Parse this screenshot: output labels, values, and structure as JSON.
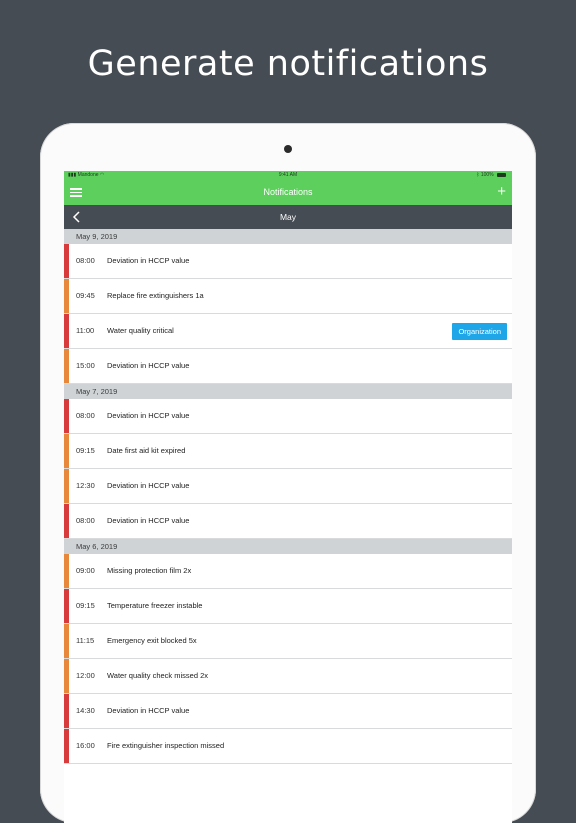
{
  "headline": "Generate notifications",
  "status_bar": {
    "carrier": "Mandone",
    "time": "9:41 AM",
    "battery": "100%"
  },
  "app_bar": {
    "title": "Notifications"
  },
  "month_bar": {
    "title": "May"
  },
  "colors": {
    "red": "#d73b3b",
    "orange": "#e8883a",
    "green": "#5ccf5c",
    "dark": "#454c53",
    "badge": "#1fa6e8"
  },
  "groups": [
    {
      "date": "May 9, 2019",
      "items": [
        {
          "time": "08:00",
          "text": "Deviation in HCCP value",
          "level": "red"
        },
        {
          "time": "09:45",
          "text": "Replace fire extinguishers 1a",
          "level": "orange"
        },
        {
          "time": "11:00",
          "text": "Water quality critical",
          "level": "red",
          "badge": "Organization"
        },
        {
          "time": "15:00",
          "text": "Deviation in HCCP value",
          "level": "orange"
        }
      ]
    },
    {
      "date": "May 7, 2019",
      "items": [
        {
          "time": "08:00",
          "text": "Deviation in HCCP value",
          "level": "red"
        },
        {
          "time": "09:15",
          "text": "Date first aid kit expired",
          "level": "orange"
        },
        {
          "time": "12:30",
          "text": "Deviation in HCCP value",
          "level": "orange"
        },
        {
          "time": "08:00",
          "text": "Deviation in HCCP value",
          "level": "red"
        }
      ]
    },
    {
      "date": "May 6, 2019",
      "items": [
        {
          "time": "09:00",
          "text": "Missing protection film 2x",
          "level": "orange"
        },
        {
          "time": "09:15",
          "text": "Temperature freezer instable",
          "level": "red"
        },
        {
          "time": "11:15",
          "text": "Emergency exit blocked 5x",
          "level": "orange"
        },
        {
          "time": "12:00",
          "text": "Water quality check missed 2x",
          "level": "orange"
        },
        {
          "time": "14:30",
          "text": "Deviation in HCCP value",
          "level": "red"
        },
        {
          "time": "16:00",
          "text": "Fire extinguisher inspection missed",
          "level": "red"
        }
      ]
    }
  ]
}
